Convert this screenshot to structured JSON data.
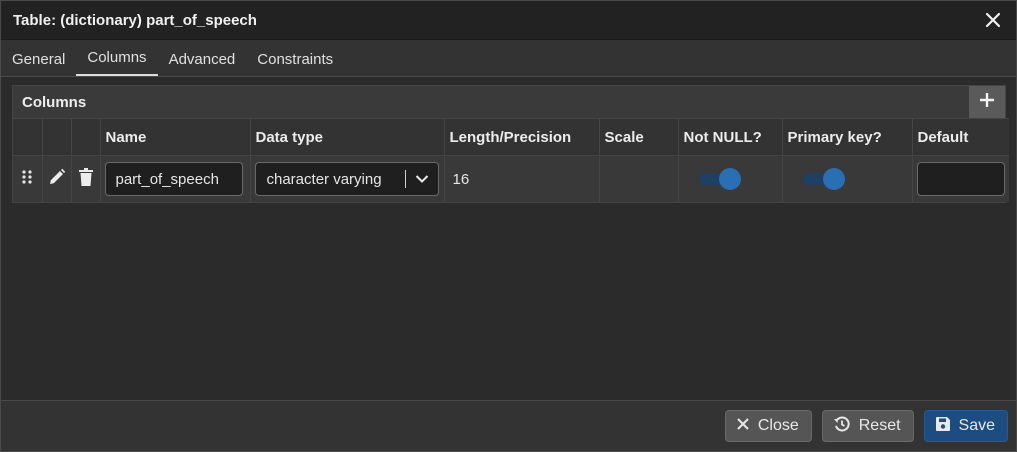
{
  "dialog": {
    "title": "Table: (dictionary) part_of_speech"
  },
  "tabs": [
    {
      "label": "General",
      "active": false
    },
    {
      "label": "Columns",
      "active": true
    },
    {
      "label": "Advanced",
      "active": false
    },
    {
      "label": "Constraints",
      "active": false
    }
  ],
  "columns_panel": {
    "label": "Columns",
    "headers": [
      "Name",
      "Data type",
      "Length/Precision",
      "Scale",
      "Not NULL?",
      "Primary key?",
      "Default"
    ],
    "rows": [
      {
        "name": "part_of_speech",
        "data_type": "character varying",
        "length_precision": "16",
        "scale": "",
        "not_null": true,
        "primary_key": true,
        "default": ""
      }
    ]
  },
  "footer": {
    "close_label": "Close",
    "reset_label": "Reset",
    "save_label": "Save"
  },
  "colors": {
    "accent": "#1d4d80",
    "toggle_on": "#2a6fb3"
  },
  "icons": [
    "close-icon",
    "plus-icon",
    "drag-handle-icon",
    "edit-icon",
    "delete-icon",
    "chevron-down-icon",
    "reset-icon",
    "save-icon"
  ]
}
